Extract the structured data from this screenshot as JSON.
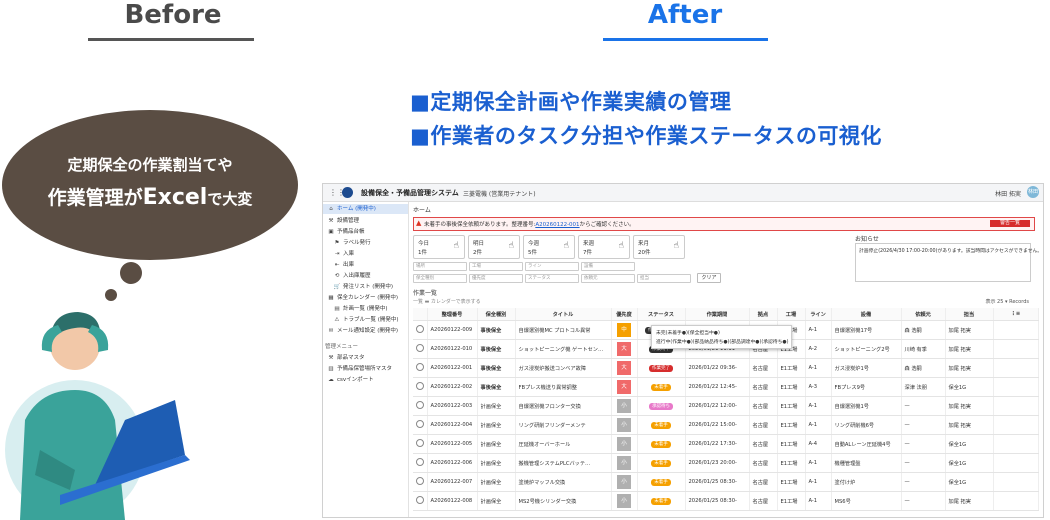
{
  "labels": {
    "before": "Before",
    "after": "After"
  },
  "headlines": [
    "■定期保全計画や作業実績の管理",
    "■作業者のタスク分担や作業ステータスの可視化"
  ],
  "bubble": {
    "line1": "定期保全の作業割当てや",
    "line2_a": "作業管理が",
    "line2_b": "Excel",
    "line2_c": "で大変"
  },
  "colors": {
    "accent": "#1a73e8",
    "bubble": "#5a4d43",
    "danger": "#d62d2d",
    "orange": "#f5a000"
  },
  "app": {
    "title": "設備保全・予備品管理システム",
    "tenant": "三菱電機 (営業用テナント)",
    "user": "林田 拓実",
    "avatar": "林田",
    "breadcrumb": "ホーム",
    "alert": {
      "prefix": "未着手の事後保全依頼があります。整理番号:",
      "link": "A20260122-001",
      "suffix": "からご確認ください。",
      "button": "警告一覧"
    },
    "notice": {
      "title": "お知らせ",
      "body": "計画停止(2026/4/30 17:00-20:00)があります。該当時間はアクセスができません。"
    },
    "sidebar": [
      {
        "icon": "⌂",
        "label": "ホーム (開発中)",
        "active": true,
        "indent": 0
      },
      {
        "icon": "⚒",
        "label": "設備管理",
        "active": false,
        "indent": 0
      },
      {
        "icon": "▣",
        "label": "予備品台帳",
        "active": false,
        "indent": 0
      },
      {
        "icon": "⚑",
        "label": "ラベル発行",
        "active": false,
        "indent": 1
      },
      {
        "icon": "⇥",
        "label": "入庫",
        "active": false,
        "indent": 1
      },
      {
        "icon": "⇤",
        "label": "出庫",
        "active": false,
        "indent": 1
      },
      {
        "icon": "⟲",
        "label": "入出庫履歴",
        "active": false,
        "indent": 1
      },
      {
        "icon": "🛒",
        "label": "発注リスト (開発中)",
        "active": false,
        "indent": 1
      },
      {
        "icon": "▦",
        "label": "保全カレンダー (開発中)",
        "active": false,
        "indent": 0
      },
      {
        "icon": "▤",
        "label": "計画一覧 (開発中)",
        "active": false,
        "indent": 1
      },
      {
        "icon": "⚠",
        "label": "トラブル一覧 (開発中)",
        "active": false,
        "indent": 1
      },
      {
        "icon": "✉",
        "label": "メール通知設定 (開発中)",
        "active": false,
        "indent": 0
      },
      {
        "icon": "",
        "label": "管理メニュー",
        "active": false,
        "indent": 0,
        "section": true
      },
      {
        "icon": "⚒",
        "label": "部品マスタ",
        "active": false,
        "indent": 0
      },
      {
        "icon": "▥",
        "label": "予備品保管場所マスタ",
        "active": false,
        "indent": 0
      },
      {
        "icon": "☁",
        "label": "csvインポート",
        "active": false,
        "indent": 0
      }
    ],
    "cards": [
      {
        "l1": "今日",
        "l2": "1件"
      },
      {
        "l1": "明日",
        "l2": "2件"
      },
      {
        "l1": "今週",
        "l2": "5件"
      },
      {
        "l1": "来週",
        "l2": "7件"
      },
      {
        "l1": "来月",
        "l2": "20件"
      }
    ],
    "filters_row1": [
      "場所",
      "工場",
      "ライン",
      "設備"
    ],
    "filters_row2": [
      "保全種別",
      "優先度",
      "ステータス",
      "依頼元",
      "担当"
    ],
    "clear_label": "クリア",
    "list_label": "作業一覧",
    "toggle_label": "カレンダーで表示する",
    "toggle_left": "一覧",
    "pager": "表示 25 ▾ Records",
    "columns": [
      "",
      "整理番号",
      "保全種別",
      "タイトル",
      "優先度",
      "ステータス",
      "作業期間",
      "拠点",
      "工場",
      "ライン",
      "設備",
      "依頼元",
      "担当",
      "⋮≡"
    ],
    "rows": [
      {
        "no": "A20260122-009",
        "kind": "事後保全",
        "kindType": "acc",
        "title": "自爆選別機MC プロトコル異常",
        "prio": "中",
        "prioColor": "#f5a000",
        "status": "作業中(遅延)",
        "statusColor": "#333333",
        "period": "2026/01/21 11:11-",
        "site": "名古屋",
        "factory": "E1工場",
        "line": "A-1",
        "equip": "自爆選別機17号",
        "req": "森 浩嗣",
        "assignee": "加尾 拓実"
      },
      {
        "no": "A20260122-010",
        "kind": "事後保全",
        "kindType": "acc",
        "title": "ショットピーニング機 ゲートセン…",
        "prio": "大",
        "prioColor": "#f06a6a",
        "status": "作業時中",
        "statusColor": "#333333",
        "period": "2026/01/21 11:11-",
        "site": "名古屋",
        "factory": "E1工場",
        "line": "A-2",
        "equip": "ショットピーニング2号",
        "req": "川崎 有季",
        "assignee": "加尾 拓実"
      },
      {
        "no": "A20260122-001",
        "kind": "事後保全",
        "kindType": "acc",
        "title": "ガス浸炭炉搬送コンベア故障",
        "prio": "大",
        "prioColor": "#f06a6a",
        "status": "作業完了",
        "statusColor": "#d62d2d",
        "period": "2026/01/22 09:36-",
        "site": "名古屋",
        "factory": "E1工場",
        "line": "A-1",
        "equip": "ガス浸炭炉1号",
        "req": "森 浩嗣",
        "assignee": "加尾 拓実"
      },
      {
        "no": "A20260122-002",
        "kind": "事後保全",
        "kindType": "acc",
        "title": "FBプレス機送り異常調整",
        "prio": "大",
        "prioColor": "#f06a6a",
        "status": "未着手",
        "statusColor": "#f5a000",
        "period": "2026/01/22 12:45-",
        "site": "名古屋",
        "factory": "E1工場",
        "line": "A-3",
        "equip": "FBプレス9号",
        "req": "深津 法朋",
        "assignee": "保全1G"
      },
      {
        "no": "A20260122-003",
        "kind": "計画保全",
        "kindType": "plan",
        "title": "自爆選別機フロンター交換",
        "prio": "小",
        "prioColor": "#b0b0b0",
        "status": "承認待ち",
        "statusColor": "#e879c9",
        "period": "2026/01/22 12:00-",
        "site": "名古屋",
        "factory": "E1工場",
        "line": "A-1",
        "equip": "自爆選別機1号",
        "req": "—",
        "assignee": "加尾 拓実"
      },
      {
        "no": "A20260122-004",
        "kind": "計画保全",
        "kindType": "plan",
        "title": "リング研削フリンダーメンテ",
        "prio": "小",
        "prioColor": "#b0b0b0",
        "status": "未着手",
        "statusColor": "#f5a000",
        "period": "2026/01/22 15:00-",
        "site": "名古屋",
        "factory": "E1工場",
        "line": "A-1",
        "equip": "リング研削機6号",
        "req": "—",
        "assignee": "加尾 拓実"
      },
      {
        "no": "A20260122-005",
        "kind": "計画保全",
        "kindType": "plan",
        "title": "圧延機オーバーホール",
        "prio": "小",
        "prioColor": "#b0b0b0",
        "status": "未着手",
        "statusColor": "#f5a000",
        "period": "2026/01/22 17:30-",
        "site": "名古屋",
        "factory": "E1工場",
        "line": "A-4",
        "equip": "自動ALレーン圧延機4号",
        "req": "—",
        "assignee": "保全1G"
      },
      {
        "no": "A20260122-006",
        "kind": "計画保全",
        "kindType": "plan",
        "title": "搬機管理システムPLCバッテ…",
        "prio": "小",
        "prioColor": "#b0b0b0",
        "status": "未着手",
        "statusColor": "#f5a000",
        "period": "2026/01/23 20:00-",
        "site": "名古屋",
        "factory": "E1工場",
        "line": "A-1",
        "equip": "機種管理盤",
        "req": "—",
        "assignee": "保全1G"
      },
      {
        "no": "A20260122-007",
        "kind": "計画保全",
        "kindType": "plan",
        "title": "塗焼炉マッフル交換",
        "prio": "小",
        "prioColor": "#b0b0b0",
        "status": "未着手",
        "statusColor": "#f5a000",
        "period": "2026/01/25 08:30-",
        "site": "名古屋",
        "factory": "E1工場",
        "line": "A-1",
        "equip": "塗付け炉",
        "req": "—",
        "assignee": "保全1G"
      },
      {
        "no": "A20260122-008",
        "kind": "計画保全",
        "kindType": "plan",
        "title": "MS2号機シリンダー交換",
        "prio": "小",
        "prioColor": "#b0b0b0",
        "status": "未着手",
        "statusColor": "#f5a000",
        "period": "2026/01/25 08:30-",
        "site": "名古屋",
        "factory": "E1工場",
        "line": "A-1",
        "equip": "MS6号",
        "req": "—",
        "assignee": "加尾 拓実"
      }
    ],
    "popup": {
      "line1": "未完(未着手●)(保全担当中●)",
      "line2": "進行中(作業中●)(部品納品待ち●)(部品調達中●)(承認待ち●)"
    }
  }
}
